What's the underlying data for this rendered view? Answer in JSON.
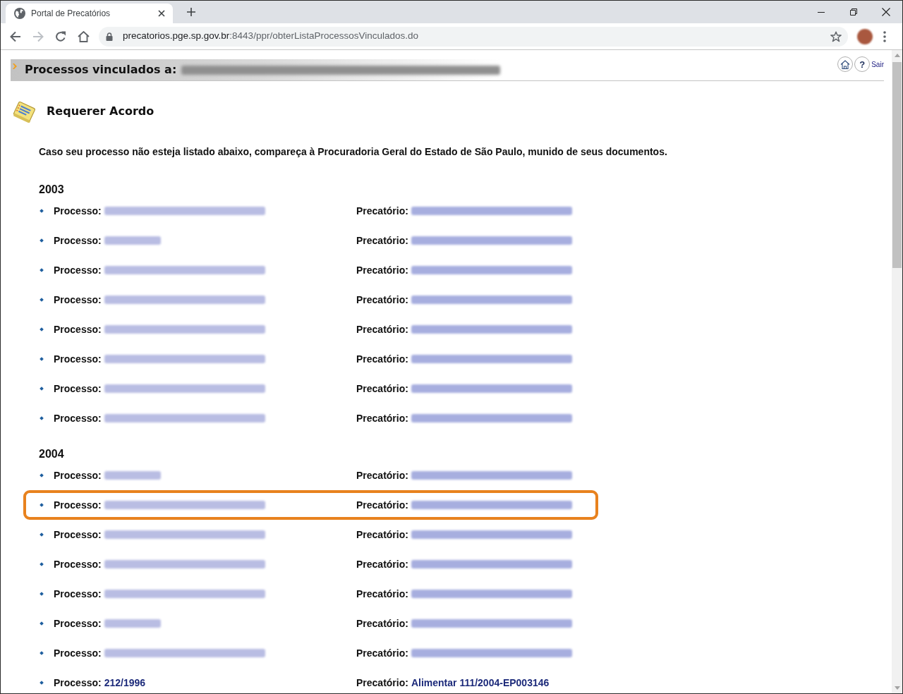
{
  "browser": {
    "tab": {
      "title": "Portal de Precatórios",
      "selected": true
    },
    "address": {
      "host": "precatorios.pge.sp.gov.br",
      "path": ":8443/ppr/obterListaProcessosVinculados.do"
    }
  },
  "header": {
    "title": "Processos vinculados a:",
    "name": {
      "kind": "blurred"
    },
    "help": "?",
    "logout": "Sair"
  },
  "action": {
    "label": "Requerer Acordo"
  },
  "notice": "Caso seu processo não esteja listado abaixo, compareça à Procuradoria Geral do Estado de São Paulo, munido de seus documentos.",
  "years": [
    {
      "label": "2003",
      "rows": [
        {
          "highlighted": false,
          "process_label": "Processo:",
          "process": {
            "kind": "blurred",
            "short": false
          },
          "precatorio_label": "Precatório:",
          "precatorio": {
            "kind": "blurred",
            "short": false
          }
        },
        {
          "highlighted": false,
          "process_label": "Processo:",
          "process": {
            "kind": "blurred",
            "short": true
          },
          "precatorio_label": "Precatório:",
          "precatorio": {
            "kind": "blurred",
            "short": false
          }
        },
        {
          "highlighted": false,
          "process_label": "Processo:",
          "process": {
            "kind": "blurred",
            "short": false
          },
          "precatorio_label": "Precatório:",
          "precatorio": {
            "kind": "blurred",
            "short": false
          }
        },
        {
          "highlighted": false,
          "process_label": "Processo:",
          "process": {
            "kind": "blurred",
            "short": false
          },
          "precatorio_label": "Precatório:",
          "precatorio": {
            "kind": "blurred",
            "short": false
          }
        },
        {
          "highlighted": false,
          "process_label": "Processo:",
          "process": {
            "kind": "blurred",
            "short": false
          },
          "precatorio_label": "Precatório:",
          "precatorio": {
            "kind": "blurred",
            "short": false
          }
        },
        {
          "highlighted": false,
          "process_label": "Processo:",
          "process": {
            "kind": "blurred",
            "short": false
          },
          "precatorio_label": "Precatório:",
          "precatorio": {
            "kind": "blurred",
            "short": false
          }
        },
        {
          "highlighted": false,
          "process_label": "Processo:",
          "process": {
            "kind": "blurred",
            "short": false
          },
          "precatorio_label": "Precatório:",
          "precatorio": {
            "kind": "blurred",
            "short": false
          }
        },
        {
          "highlighted": false,
          "process_label": "Processo:",
          "process": {
            "kind": "blurred",
            "short": false
          },
          "precatorio_label": "Precatório:",
          "precatorio": {
            "kind": "blurred",
            "short": false
          }
        }
      ]
    },
    {
      "label": "2004",
      "rows": [
        {
          "highlighted": false,
          "process_label": "Processo:",
          "process": {
            "kind": "blurred",
            "short": true
          },
          "precatorio_label": "Precatório:",
          "precatorio": {
            "kind": "blurred",
            "short": false
          }
        },
        {
          "highlighted": true,
          "process_label": "Processo:",
          "process": {
            "kind": "blurred",
            "short": false
          },
          "precatorio_label": "Precatório:",
          "precatorio": {
            "kind": "blurred",
            "short": false
          }
        },
        {
          "highlighted": false,
          "process_label": "Processo:",
          "process": {
            "kind": "blurred",
            "short": false
          },
          "precatorio_label": "Precatório:",
          "precatorio": {
            "kind": "blurred",
            "short": false
          }
        },
        {
          "highlighted": false,
          "process_label": "Processo:",
          "process": {
            "kind": "blurred",
            "short": false
          },
          "precatorio_label": "Precatório:",
          "precatorio": {
            "kind": "blurred",
            "short": false
          }
        },
        {
          "highlighted": false,
          "process_label": "Processo:",
          "process": {
            "kind": "blurred",
            "short": false
          },
          "precatorio_label": "Precatório:",
          "precatorio": {
            "kind": "blurred",
            "short": false
          }
        },
        {
          "highlighted": false,
          "process_label": "Processo:",
          "process": {
            "kind": "blurred",
            "short": true
          },
          "precatorio_label": "Precatório:",
          "precatorio": {
            "kind": "blurred",
            "short": false
          }
        },
        {
          "highlighted": false,
          "process_label": "Processo:",
          "process": {
            "kind": "blurred",
            "short": false
          },
          "precatorio_label": "Precatório:",
          "precatorio": {
            "kind": "blurred",
            "short": false
          }
        },
        {
          "highlighted": false,
          "process_label": "Processo:",
          "process": {
            "kind": "text",
            "text": "212/1996"
          },
          "precatorio_label": "Precatório:",
          "precatorio": {
            "kind": "text",
            "text": "Alimentar 111/2004-EP003146"
          }
        }
      ]
    }
  ]
}
